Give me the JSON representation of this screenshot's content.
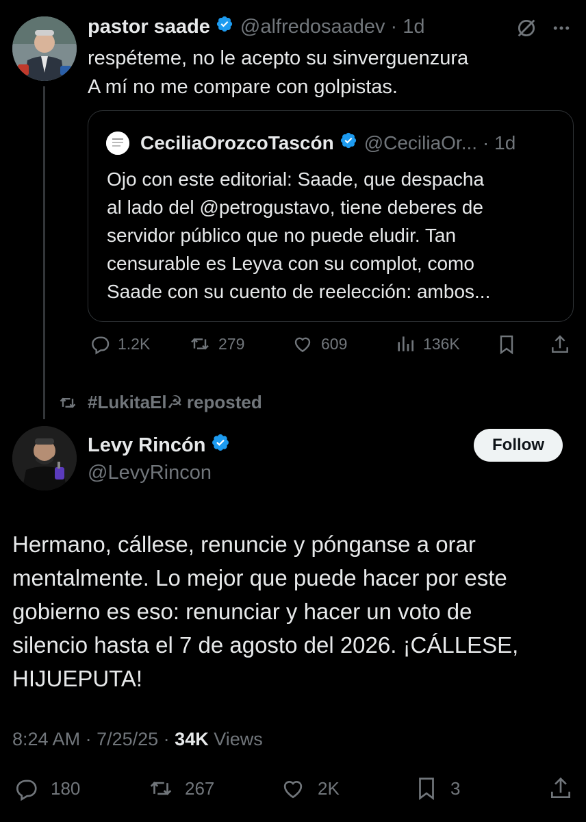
{
  "parent_tweet": {
    "author_name": "pastor saade",
    "handle": "@alfredosaadev",
    "time": "· 1d",
    "lines": [
      "respéteme, no le acepto su sinverguenzura",
      "A mí no me compare con golpistas."
    ],
    "quote": {
      "author_name": "CeciliaOrozcoTascón",
      "handle": "@CeciliaOr...",
      "time": "· 1d",
      "lines": [
        "Ojo con este editorial: Saade, que despacha",
        "al lado del @petrogustavo, tiene deberes de",
        "servidor público que no puede eludir. Tan",
        "censurable es Leyva con su complot, como",
        "Saade con su cuento de reelección: ambos..."
      ]
    },
    "actions": {
      "replies": "1.2K",
      "reposts": "279",
      "likes": "609",
      "views": "136K"
    }
  },
  "repost_banner": {
    "user": "#LukitaEl☭",
    "label": "reposted"
  },
  "main_tweet": {
    "author_name": "Levy Rincón",
    "handle": "@LevyRincon",
    "follow_label": "Follow",
    "lines": [
      "Hermano, cállese, renuncie y pónganse a orar",
      "mentalmente. Lo mejor que puede hacer por este",
      "gobierno es eso: renunciar y hacer un voto de",
      "silencio hasta el 7 de agosto del 2026. ¡CÁLLESE,",
      "HIJUEPUTA!"
    ],
    "meta": {
      "time": "8:24 AM",
      "date": "· 7/25/25 ·",
      "views_count": "34K",
      "views_label": "Views"
    },
    "actions": {
      "replies": "180",
      "reposts": "267",
      "likes": "2K",
      "bookmarks": "3"
    }
  },
  "colors": {
    "background": "#000000",
    "text": "#e7e9ea",
    "muted": "#71767b",
    "verified": "#1d9bf0",
    "border": "#2f3336"
  },
  "icons": [
    "verified-badge-icon",
    "grok-icon",
    "more-icon",
    "reply-icon",
    "repost-icon",
    "like-icon",
    "views-icon",
    "bookmark-icon",
    "share-icon"
  ]
}
